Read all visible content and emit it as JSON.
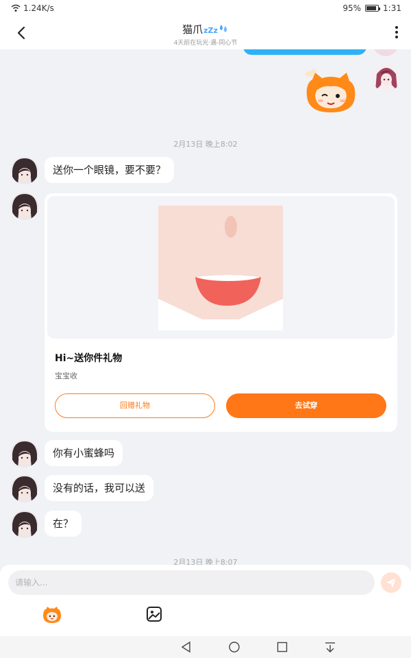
{
  "status_bar": {
    "network_speed": "1.24K/s",
    "battery_percent": "95%",
    "time": "1:31",
    "icons": [
      "wifi-icon",
      "battery-icon"
    ]
  },
  "header": {
    "title": "猫爪",
    "title_badge": "zZz",
    "subtitle": "4天前在玩光·遇-同心节",
    "icons": [
      "back-arrow-icon",
      "zzz-icon",
      "water-drop-icon",
      "more-vertical-icon"
    ]
  },
  "messages": {
    "time_1": "2月13日 晚上8:02",
    "msg_1": "送你一个眼镜，要不要？",
    "gift_card": {
      "title": "Hi~送你件礼物",
      "subtitle": "宝宝收",
      "return_button": "回赠礼物",
      "try_button": "去试穿"
    },
    "msg_2": "你有小蜜蜂吗",
    "msg_3": "没有的话，我可以送",
    "msg_4": "在？",
    "time_2": "2月13日 晚上8:07"
  },
  "input_bar": {
    "placeholder": "请输入...",
    "icons": [
      "send-icon",
      "mascot-emoji-icon",
      "image-icon"
    ]
  },
  "nav_bar": {
    "icons": [
      "nav-back-icon",
      "nav-home-icon",
      "nav-recents-icon",
      "nav-down-icon"
    ]
  },
  "colors": {
    "accent_orange": "#ff7716",
    "my_bubble_blue": "#2fb1f5",
    "background": "#f0f2f6"
  }
}
